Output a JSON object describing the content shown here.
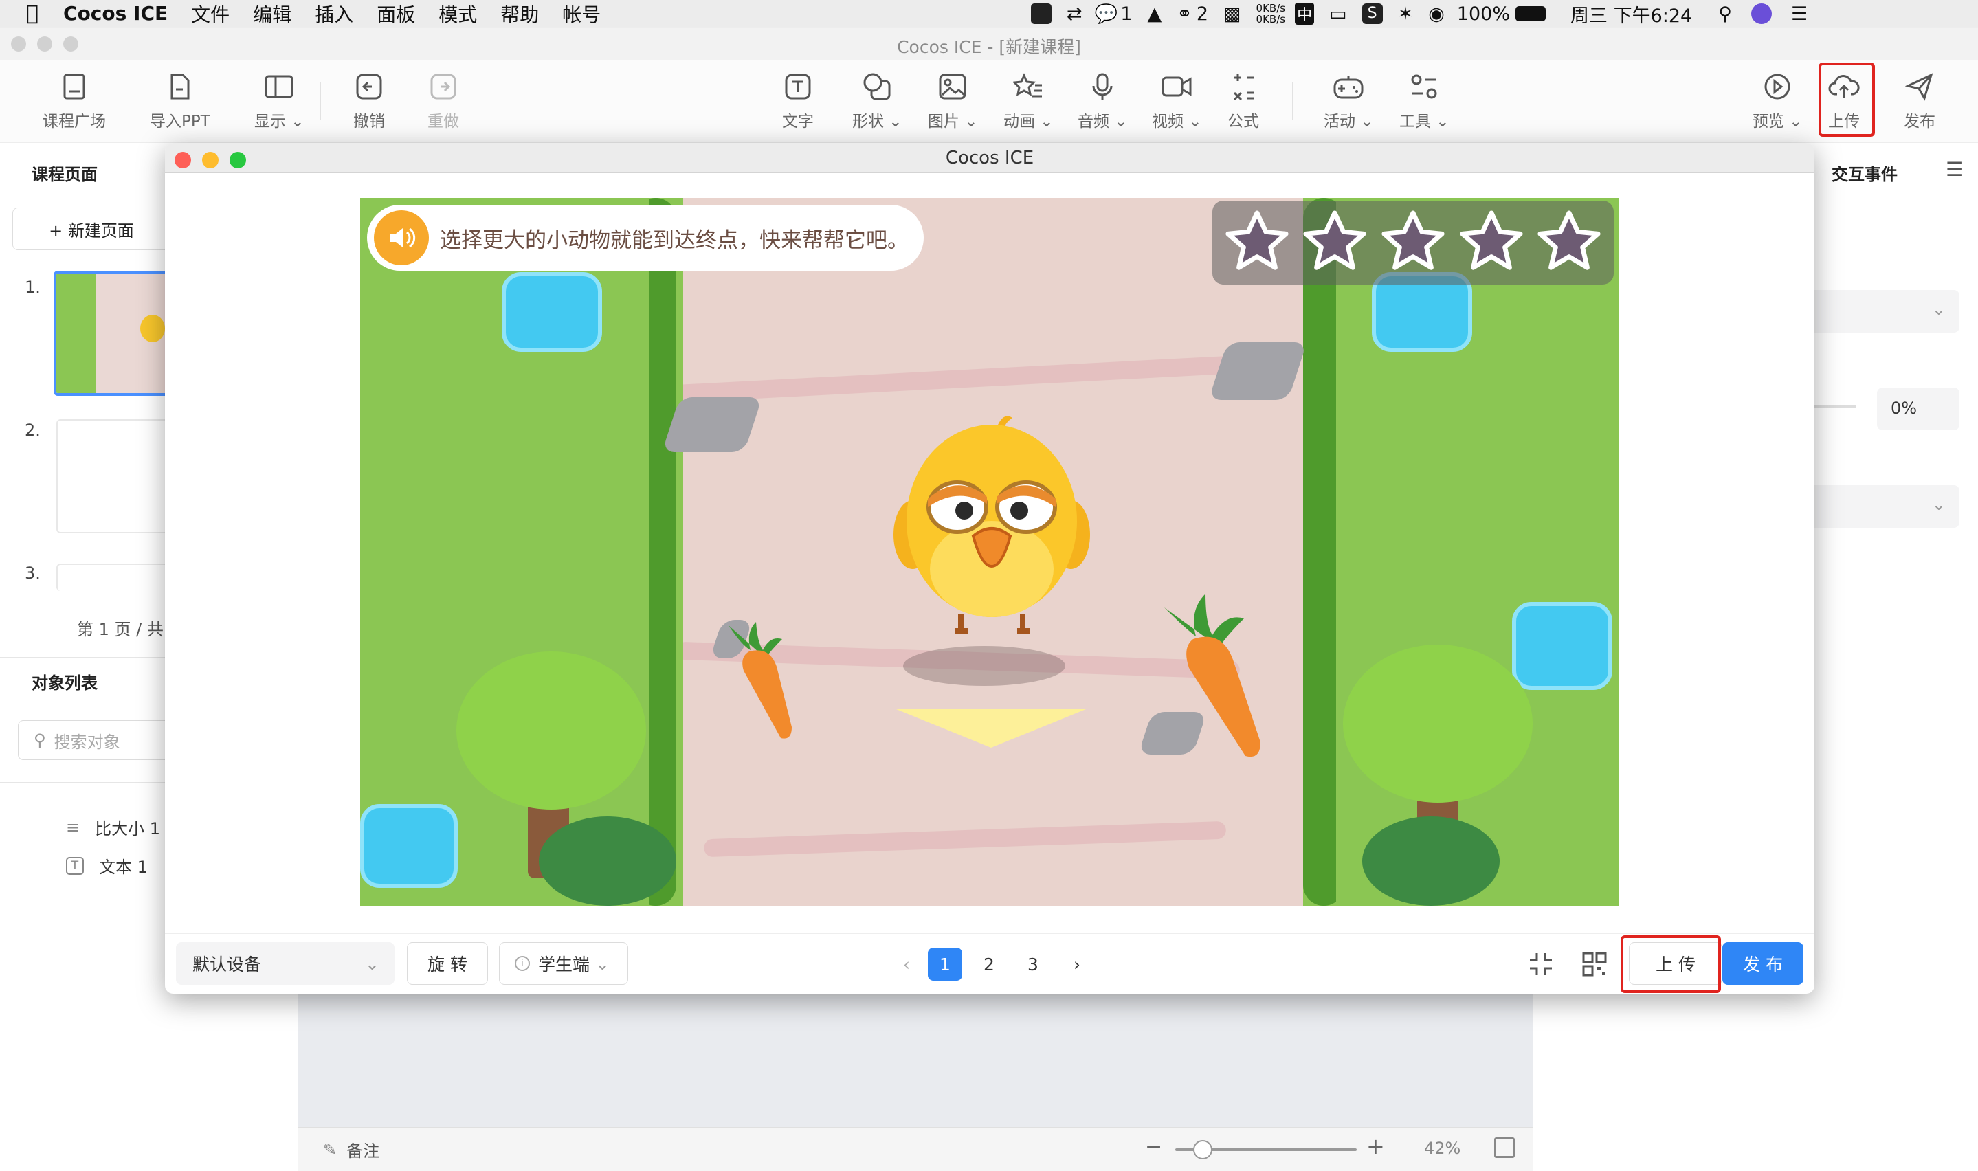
{
  "menubar": {
    "app_name": "Cocos ICE",
    "items": [
      "文件",
      "编辑",
      "插入",
      "面板",
      "模式",
      "帮助",
      "帐号"
    ],
    "status": {
      "notification_count": "1",
      "wechat_count": "2",
      "net_up": "0KB/s",
      "net_down": "0KB/s",
      "input_method": "中",
      "battery": "100%",
      "clock": "周三 下午6:24"
    }
  },
  "window": {
    "title": "Cocos ICE - [新建课程]"
  },
  "toolbar": {
    "left": [
      {
        "label": "课程广场",
        "icon": "book-icon"
      },
      {
        "label": "导入PPT",
        "icon": "file-import-icon"
      },
      {
        "label": "显示",
        "icon": "layout-icon"
      },
      {
        "label": "撤销",
        "icon": "undo-icon"
      },
      {
        "label": "重做",
        "icon": "redo-icon"
      }
    ],
    "center": [
      {
        "label": "文字",
        "icon": "text-icon"
      },
      {
        "label": "形状",
        "icon": "shape-icon"
      },
      {
        "label": "图片",
        "icon": "image-icon"
      },
      {
        "label": "动画",
        "icon": "animation-icon"
      },
      {
        "label": "音频",
        "icon": "microphone-icon"
      },
      {
        "label": "视频",
        "icon": "video-icon"
      },
      {
        "label": "公式",
        "icon": "formula-icon"
      },
      {
        "label": "活动",
        "icon": "gamepad-icon"
      },
      {
        "label": "工具",
        "icon": "tools-icon"
      }
    ],
    "right": [
      {
        "label": "预览",
        "icon": "play-icon"
      },
      {
        "label": "上传",
        "icon": "cloud-upload-icon"
      },
      {
        "label": "发布",
        "icon": "send-icon"
      }
    ]
  },
  "left_panel": {
    "pages_tab": "课程页面",
    "new_page_button": "+ 新建页面",
    "page_numbers": [
      "1.",
      "2.",
      "3."
    ],
    "pagination": "第 1 页 / 共",
    "objects_tab": "对象列表",
    "search_placeholder": "搜索对象",
    "objects": [
      {
        "label": "比大小 1",
        "icon": "sliders-icon"
      },
      {
        "label": "文本 1",
        "icon": "text-icon"
      }
    ]
  },
  "right_panel": {
    "tab": "交互事件",
    "percent_value": "0%"
  },
  "bottom_bar": {
    "notes": "备注",
    "zoom": "42%"
  },
  "modal": {
    "title": "Cocos ICE",
    "game": {
      "prompt": "选择更大的小动物就能到达终点，快来帮帮它吧。",
      "stars_total": 5,
      "stars_earned": 0
    },
    "footer": {
      "device_select": "默认设备",
      "rotate_button": "旋 转",
      "role_select": "学生端",
      "pages": [
        "1",
        "2",
        "3"
      ],
      "current_page": "1",
      "upload_button": "上 传",
      "publish_button": "发 布"
    }
  },
  "colors": {
    "accent_blue": "#2f86f6",
    "highlight_red": "#e0241f",
    "grass_green": "#8bc653",
    "path_pink": "#e9d3cd"
  }
}
